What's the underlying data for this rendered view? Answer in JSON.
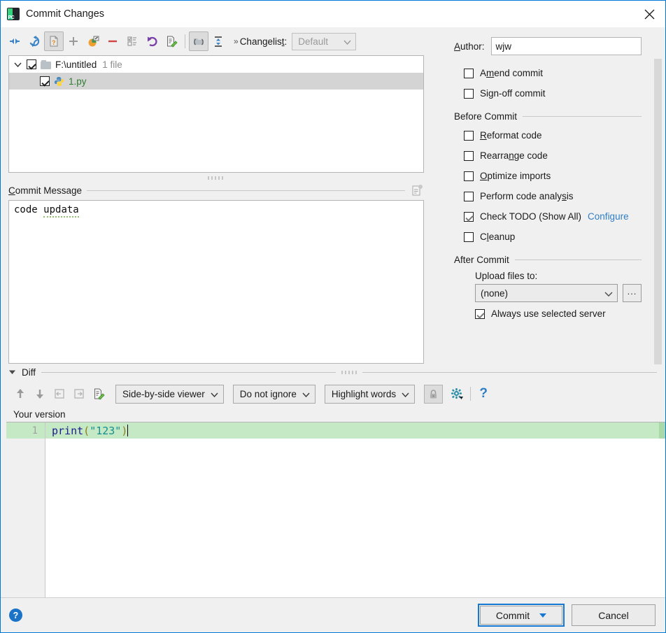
{
  "window": {
    "title": "Commit Changes",
    "app_icon": "pycharm-logo-icon",
    "close_icon": "close-icon",
    "accent_color": "#0078d7"
  },
  "changelist_toolbar": {
    "buttons": [
      {
        "name": "collapse-all-icon",
        "tooltip": "Collapse All",
        "pressed": false
      },
      {
        "name": "refresh-icon",
        "tooltip": "Refresh Changes",
        "pressed": false
      },
      {
        "name": "show-diff-unversioned-icon",
        "tooltip": "Show Unversioned Files",
        "pressed": true
      },
      {
        "name": "new-changelist-plus-icon",
        "tooltip": "New Changelist",
        "pressed": false
      },
      {
        "name": "move-to-another-changelist-icon",
        "tooltip": "Move to Another Changelist",
        "pressed": false
      },
      {
        "name": "delete-changelist-minus-icon",
        "tooltip": "Delete Changelist",
        "pressed": false
      },
      {
        "name": "set-active-changelist-icon",
        "tooltip": "Set Active Changelist",
        "pressed": false
      },
      {
        "name": "rollback-icon",
        "tooltip": "Rollback",
        "pressed": false
      },
      {
        "name": "edit-source-icon",
        "tooltip": "Edit Source",
        "pressed": false
      },
      {
        "name": "group-by-directory-icon",
        "tooltip": "Group by Directory",
        "pressed": true
      },
      {
        "name": "expand-collapse-icon",
        "tooltip": "Expand / Collapse",
        "pressed": false
      }
    ],
    "changelist_label": "Changelist:",
    "changelist_mnemonic_prefix": "Changelis",
    "changelist_mnemonic": "t",
    "changelist_mnemonic_suffix": ":",
    "changelist_value": "Default",
    "chevron_prefix": "»"
  },
  "file_tree": {
    "rows": [
      {
        "name": "tree-row-folder",
        "indent": 0,
        "expanded": true,
        "checked": true,
        "icon": "folder-icon",
        "label": "F:\\untitled",
        "sub_label": "1 file",
        "selected": false,
        "added": false
      },
      {
        "name": "tree-row-file",
        "indent": 1,
        "expanded": null,
        "checked": true,
        "icon": "python-file-icon",
        "label": "1.py",
        "sub_label": "",
        "selected": true,
        "added": true
      }
    ]
  },
  "commit_message": {
    "title": "Commit Message",
    "title_mnemonic": "C",
    "title_rest": "ommit Message",
    "value_ok": "code ",
    "value_misspelled": "updata",
    "history_icon": "commit-message-history-icon"
  },
  "right_panel": {
    "author": {
      "label_mnemonic": "A",
      "label_rest": "uthor:",
      "value": "wjw"
    },
    "top_checkboxes": [
      {
        "name": "amend-commit-checkbox",
        "pre": "A",
        "mn": "m",
        "post": "end commit",
        "checked": false
      },
      {
        "name": "sign-off-commit-checkbox",
        "pre": "Si",
        "mn": "g",
        "post": "n-off commit",
        "checked": false
      }
    ],
    "before_commit": {
      "title": "Before Commit",
      "checkboxes": [
        {
          "name": "reformat-code-checkbox",
          "pre": "",
          "mn": "R",
          "post": "eformat code",
          "checked": false,
          "link": ""
        },
        {
          "name": "rearrange-code-checkbox",
          "pre": "Rearra",
          "mn": "n",
          "post": "ge code",
          "checked": false,
          "link": ""
        },
        {
          "name": "optimize-imports-checkbox",
          "pre": "",
          "mn": "O",
          "post": "ptimize imports",
          "checked": false,
          "link": ""
        },
        {
          "name": "perform-code-analysis-checkbox",
          "pre": "Perform code analy",
          "mn": "s",
          "post": "is",
          "checked": false,
          "link": ""
        },
        {
          "name": "check-todo-checkbox",
          "pre": "Check TODO (Show All)",
          "mn": "",
          "post": "",
          "checked": true,
          "link": "Configure"
        },
        {
          "name": "cleanup-checkbox",
          "pre": "C",
          "mn": "l",
          "post": "eanup",
          "checked": false,
          "link": ""
        }
      ]
    },
    "after_commit": {
      "title": "After Commit",
      "upload_label": "Upload files to:",
      "upload_value": "(none)",
      "browse_label": "...",
      "always_use_checkbox": {
        "name": "always-use-selected-server-checkbox",
        "label": "Always use selected server",
        "checked": true
      }
    }
  },
  "diff": {
    "section_title": "Diff",
    "expanded": true,
    "toolbar_buttons": [
      {
        "name": "previous-difference-icon",
        "tooltip": "Previous Difference"
      },
      {
        "name": "next-difference-icon",
        "tooltip": "Next Difference"
      },
      {
        "name": "accept-left-icon",
        "tooltip": "Accept Left Side"
      },
      {
        "name": "accept-right-icon",
        "tooltip": "Accept Right Side"
      },
      {
        "name": "edit-source-icon",
        "tooltip": "Jump to Source"
      }
    ],
    "viewer_mode": "Side-by-side viewer",
    "ignore_mode": "Do not ignore",
    "highlight_mode": "Highlight words",
    "lock_icon": "lock-icon",
    "settings_icon": "gear-icon",
    "help_icon": "question-mark-icon",
    "pane_label": "Your version",
    "line_number": "1",
    "code_tokens": [
      {
        "text": "print",
        "type": "function"
      },
      {
        "text": "(",
        "type": "paren"
      },
      {
        "text": "\"123\"",
        "type": "string"
      },
      {
        "text": ")",
        "type": "paren"
      }
    ],
    "line_highlight_color": "#c5e8c5"
  },
  "footer": {
    "help_label": "?",
    "commit_label": "Commit",
    "cancel_label": "Cancel"
  }
}
